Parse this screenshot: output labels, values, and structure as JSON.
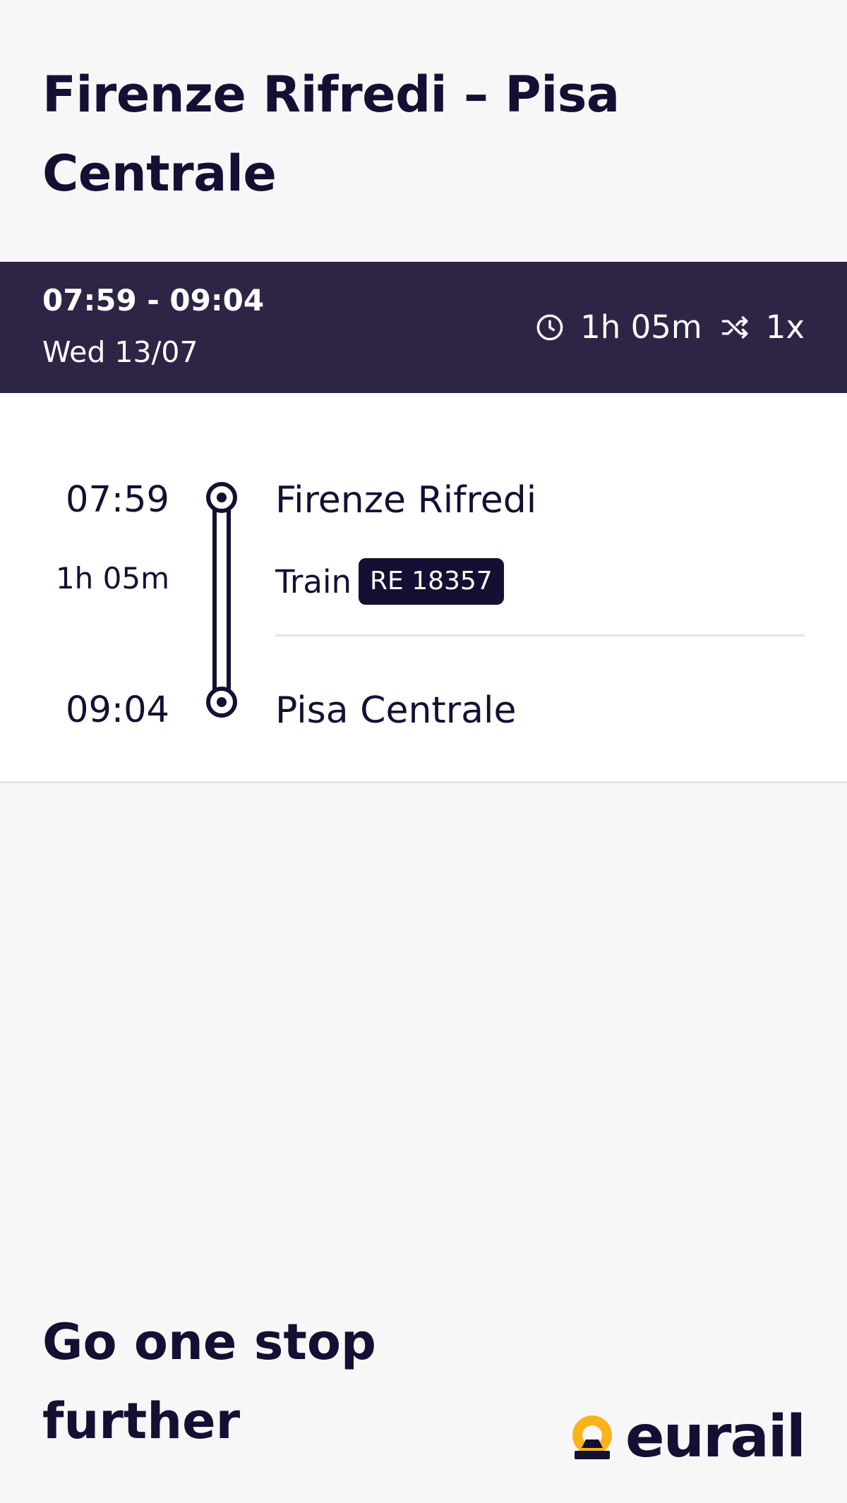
{
  "route": {
    "title": "Firenze Rifredi – Pisa Centrale"
  },
  "summary": {
    "times": "07:59 - 09:04",
    "date": "Wed 13/07",
    "duration": "1h 05m",
    "transfers": "1x",
    "duration_icon": "clock-icon",
    "transfers_icon": "shuffle-icon",
    "background_color": "#2e2445"
  },
  "journey": {
    "departure_time": "07:59",
    "departure_station": "Firenze Rifredi",
    "duration": "1h 05m",
    "mode": "Train",
    "train_number": "RE 18357",
    "arrival_time": "09:04",
    "arrival_station": "Pisa Centrale"
  },
  "footer": {
    "tagline": "Go one stop further",
    "logo_text": "eurail",
    "logo_accent": "#f9b31c",
    "brand_dark": "#150f33"
  }
}
